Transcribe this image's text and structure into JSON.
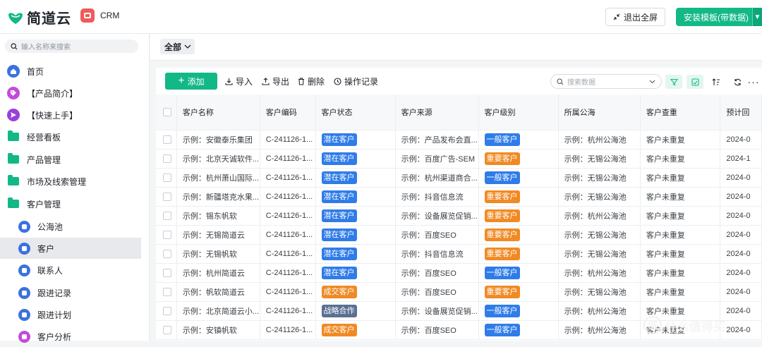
{
  "header": {
    "logo_text": "简道云",
    "app_name": "CRM",
    "exit_fullscreen": "退出全屏",
    "install_template": "安装模板(带数据)"
  },
  "sidebar": {
    "search_placeholder": "输入名称来搜索",
    "items": [
      {
        "label": "首页",
        "icon": "home-icon"
      },
      {
        "label": "【产品简介】",
        "icon": "tag-icon"
      },
      {
        "label": "【快速上手】",
        "icon": "send-icon"
      },
      {
        "label": "经营看板",
        "icon": "folder-icon"
      },
      {
        "label": "产品管理",
        "icon": "folder-icon"
      },
      {
        "label": "市场及线索管理",
        "icon": "folder-icon"
      },
      {
        "label": "客户管理",
        "icon": "folder-open-icon"
      },
      {
        "label": "公海池",
        "icon": "users-icon"
      },
      {
        "label": "客户",
        "icon": "user-icon"
      },
      {
        "label": "联系人",
        "icon": "contact-icon"
      },
      {
        "label": "跟进记录",
        "icon": "record-icon"
      },
      {
        "label": "跟进计划",
        "icon": "plan-icon"
      },
      {
        "label": "客户分析",
        "icon": "analysis-icon"
      }
    ]
  },
  "filter": {
    "label": "全部"
  },
  "toolbar": {
    "add": "添加",
    "import": "导入",
    "export": "导出",
    "delete": "删除",
    "log": "操作记录",
    "search_placeholder": "搜索数据"
  },
  "table": {
    "columns": [
      "客户名称",
      "客户编码",
      "客户状态",
      "客户来源",
      "客户级别",
      "所属公海",
      "客户查重",
      "预计回"
    ],
    "rows": [
      {
        "name": "示例：安徽泰乐集团",
        "code": "C-241126-1...",
        "status": "潜在客户",
        "source": "示例：产品发布会直...",
        "level": "一般客户",
        "pool": "示例：杭州公海池",
        "dup": "客户未重复",
        "date": "2024-0"
      },
      {
        "name": "示例：北京天诚软件...",
        "code": "C-241126-1...",
        "status": "潜在客户",
        "source": "示例：百度广告-SEM",
        "level": "重要客户",
        "pool": "示例：无锡公海池",
        "dup": "客户未重复",
        "date": "2024-1"
      },
      {
        "name": "示例：杭州萧山国际...",
        "code": "C-241126-1...",
        "status": "潜在客户",
        "source": "示例：杭州渠道商合...",
        "level": "一般客户",
        "pool": "示例：无锡公海池",
        "dup": "客户未重复",
        "date": "2024-0"
      },
      {
        "name": "示例：新疆塔克水果...",
        "code": "C-241126-1...",
        "status": "潜在客户",
        "source": "示例：抖音信息流",
        "level": "重要客户",
        "pool": "示例：无锡公海池",
        "dup": "客户未重复",
        "date": "2024-0"
      },
      {
        "name": "示例：锡东帆软",
        "code": "C-241126-1...",
        "status": "潜在客户",
        "source": "示例：设备展览促销...",
        "level": "重要客户",
        "pool": "示例：杭州公海池",
        "dup": "客户未重复",
        "date": "2024-0"
      },
      {
        "name": "示例：无锡简道云",
        "code": "C-241126-1...",
        "status": "潜在客户",
        "source": "示例：百度SEO",
        "level": "重要客户",
        "pool": "示例：无锡公海池",
        "dup": "客户未重复",
        "date": "2024-0"
      },
      {
        "name": "示例：无锡帆软",
        "code": "C-241126-1...",
        "status": "潜在客户",
        "source": "示例：抖音信息流",
        "level": "重要客户",
        "pool": "示例：无锡公海池",
        "dup": "客户未重复",
        "date": "2024-0"
      },
      {
        "name": "示例：杭州简道云",
        "code": "C-241126-1...",
        "status": "潜在客户",
        "source": "示例：百度SEO",
        "level": "一般客户",
        "pool": "示例：杭州公海池",
        "dup": "客户未重复",
        "date": "2024-0"
      },
      {
        "name": "示例：帆软简道云",
        "code": "C-241126-1...",
        "status": "成交客户",
        "source": "示例：百度SEO",
        "level": "重要客户",
        "pool": "示例：无锡公海池",
        "dup": "客户未重复",
        "date": "2024-0"
      },
      {
        "name": "示例：北京简道云小...",
        "code": "C-241126-1...",
        "status": "战略合作",
        "source": "示例：设备展览促销...",
        "level": "一般客户",
        "pool": "示例：杭州公海池",
        "dup": "客户未重复",
        "date": "2024-0"
      },
      {
        "name": "示例：安镇帆软",
        "code": "C-241126-1...",
        "status": "成交客户",
        "source": "示例：百度SEO",
        "level": "一般客户",
        "pool": "示例：杭州公海池",
        "dup": "客户未重复",
        "date": "2024-0"
      }
    ]
  },
  "tag_colors": {
    "潜在客户": "#2f7ce9",
    "成交客户": "#f08a24",
    "战略合作": "#5a6f93",
    "一般客户": "#2f7ce9",
    "重要客户": "#f08a24"
  },
  "watermark": "什么值得买"
}
